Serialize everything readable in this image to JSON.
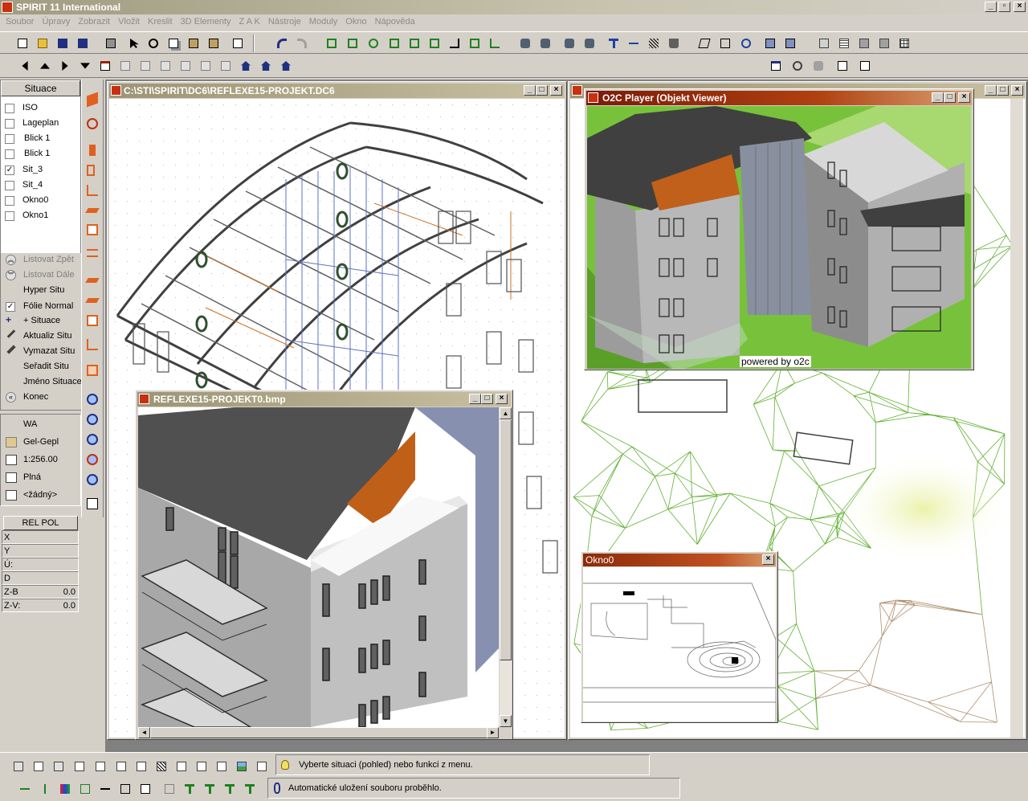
{
  "app": {
    "title": "SPIRIT 11 International"
  },
  "menu": [
    "Soubor",
    "Úpravy",
    "Zobrazit",
    "Vložit",
    "Kreslit",
    "3D Elementy",
    "Z A K",
    "Nástroje",
    "Moduly",
    "Okno",
    "Nápověda"
  ],
  "sidebar": {
    "header": "Situace",
    "items": [
      {
        "label": "ISO",
        "checked": false
      },
      {
        "label": "Lageplan",
        "checked": false
      },
      {
        "label": "Blick 1",
        "checked": false
      },
      {
        "label": "Blick 1",
        "checked": false
      },
      {
        "label": "Sit_3",
        "checked": true
      },
      {
        "label": "Sit_4",
        "checked": false
      },
      {
        "label": "Okno0",
        "checked": false
      },
      {
        "label": "Okno1",
        "checked": false
      }
    ],
    "actions": [
      {
        "label": "Listovat Zpět",
        "disabled": true
      },
      {
        "label": "Listovat Dále",
        "disabled": true
      },
      {
        "label": "Hyper Situ",
        "disabled": false
      },
      {
        "label": "Fólie Normal",
        "disabled": false
      },
      {
        "label": "+ Situace",
        "disabled": false
      },
      {
        "label": "Aktualiz Situ",
        "disabled": false
      },
      {
        "label": "Vymazat Situ",
        "disabled": false
      },
      {
        "label": "Seřadit Situ",
        "disabled": false
      },
      {
        "label": "Jméno Situace",
        "disabled": false
      },
      {
        "label": "Konec",
        "disabled": false
      }
    ],
    "props": [
      "WA",
      "Gel-Gepl",
      "1:256.00",
      "Plná",
      "<žádný>"
    ],
    "rel_header": "REL POL",
    "rel": [
      {
        "k": "X",
        "v": ""
      },
      {
        "k": "Y",
        "v": ""
      },
      {
        "k": "Ú:",
        "v": ""
      },
      {
        "k": "D",
        "v": ""
      },
      {
        "k": "Z-B",
        "v": "0.0"
      },
      {
        "k": "Z-V:",
        "v": "0.0"
      }
    ]
  },
  "windows": {
    "dc6": {
      "title": "C:\\STI\\SPIRIT\\DC6\\REFLEXE15-PROJEKT.DC6"
    },
    "bmp": {
      "title": "REFLEXE15-PROJEKT0.bmp"
    },
    "o2c": {
      "title": "O2C Player (Objekt Viewer)",
      "footer": "powered by o2c"
    },
    "okno0": {
      "title": "Okno0"
    }
  },
  "status": {
    "hint": "Vyberte situaci (pohled) nebo funkci z menu.",
    "message": "Automatické uložení souboru proběhlo."
  },
  "colors": {
    "titlebar_active": "#8b2a0a",
    "titlebar_inactive": "#9c9474",
    "accent_orange": "#cc6a10",
    "terrain": "#77c23a"
  }
}
